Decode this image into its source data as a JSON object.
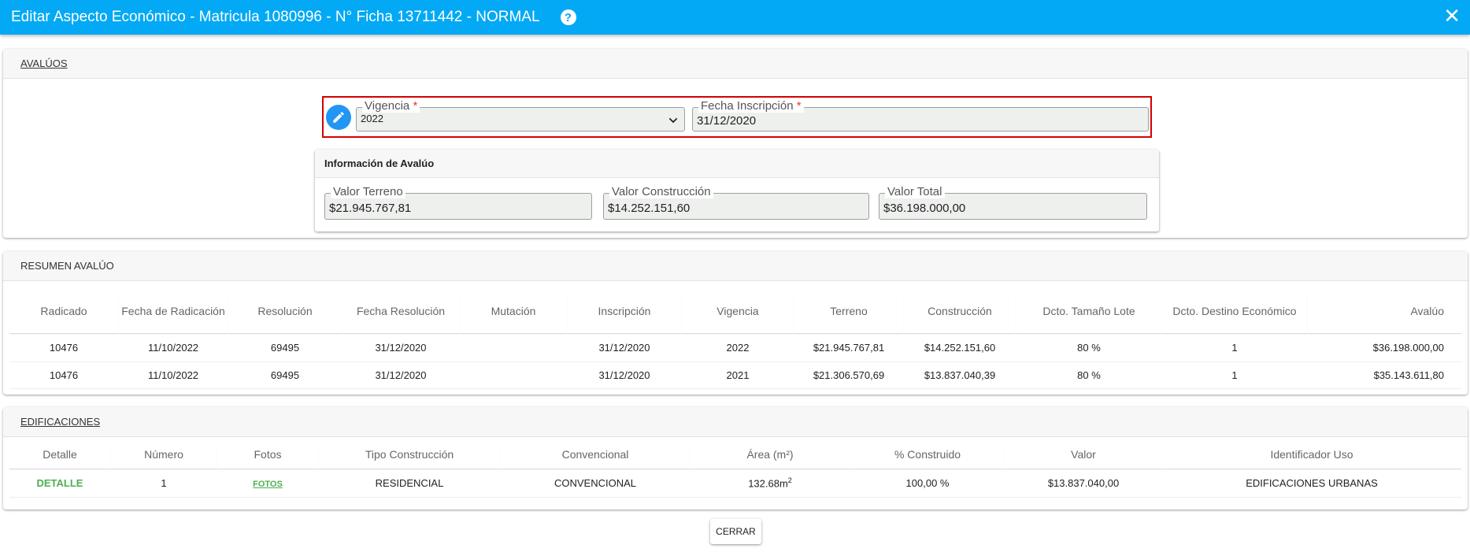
{
  "dialog": {
    "title": "Editar Aspecto Económico - Matricula 1080996 - N° Ficha 13711442 - NORMAL",
    "help_glyph": "?",
    "close_glyph": "✕"
  },
  "avaluos": {
    "header": "AVALÚOS",
    "vigencia": {
      "label": "Vigencia",
      "required": "*",
      "value": "2022"
    },
    "fecha_inscripcion": {
      "label": "Fecha Inscripción",
      "required": "*",
      "value": "31/12/2020"
    },
    "info": {
      "header": "Información de Avalúo",
      "valor_terreno": {
        "label": "Valor Terreno",
        "value": "$21.945.767,81"
      },
      "valor_construccion": {
        "label": "Valor Construcción",
        "value": "$14.252.151,60"
      },
      "valor_total": {
        "label": "Valor Total",
        "value": "$36.198.000,00"
      }
    }
  },
  "resumen": {
    "header": "RESUMEN AVALÚO",
    "columns": [
      "Radicado",
      "Fecha de Radicación",
      "Resolución",
      "Fecha Resolución",
      "Mutación",
      "Inscripción",
      "Vigencia",
      "Terreno",
      "Construcción",
      "Dcto. Tamaño Lote",
      "Dcto. Destino Económico",
      "Avalúo"
    ],
    "rows": [
      [
        "10476",
        "11/10/2022",
        "69495",
        "31/12/2020",
        "",
        "31/12/2020",
        "2022",
        "$21.945.767,81",
        "$14.252.151,60",
        "80 %",
        "1",
        "$36.198.000,00"
      ],
      [
        "10476",
        "11/10/2022",
        "69495",
        "31/12/2020",
        "",
        "31/12/2020",
        "2021",
        "$21.306.570,69",
        "$13.837.040,39",
        "80 %",
        "1",
        "$35.143.611,80"
      ]
    ]
  },
  "edificaciones": {
    "header": "EDIFICACIONES",
    "columns": [
      "Detalle",
      "Número",
      "Fotos",
      "Tipo Construcción",
      "Convencional",
      "Área (m²)",
      "% Construido",
      "Valor",
      "Identificador Uso"
    ],
    "rows": [
      {
        "detalle": "DETALLE",
        "numero": "1",
        "fotos": "FOTOS",
        "tipo": "RESIDENCIAL",
        "convencional": "CONVENCIONAL",
        "area": "132.68m",
        "area_sup": "2",
        "construido": "100,00 %",
        "valor": "$13.837.040,00",
        "uso": "EDIFICACIONES URBANAS"
      }
    ]
  },
  "footer": {
    "close_label": "CERRAR"
  },
  "colors": {
    "primary": "#03a9f4",
    "edit_icon": "#2196f3",
    "highlight_border": "#d50000",
    "link": "#4caf50"
  }
}
